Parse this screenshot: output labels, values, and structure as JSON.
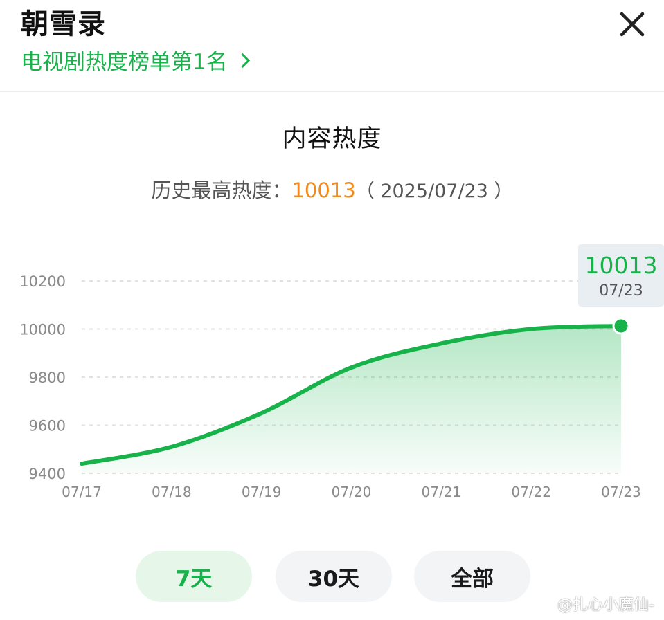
{
  "header": {
    "title": "朝雪录",
    "subtitle": "电视剧热度榜单第1名"
  },
  "section": {
    "title": "内容热度",
    "peak_label": "历史最高热度：",
    "peak_value": "10013",
    "peak_date": "（ 2025/07/23 ）"
  },
  "chart_data": {
    "type": "area",
    "categories": [
      "07/17",
      "07/18",
      "07/19",
      "07/20",
      "07/21",
      "07/22",
      "07/23"
    ],
    "series": [
      {
        "values": [
          9440,
          9510,
          9650,
          9840,
          9940,
          10000,
          10013
        ]
      }
    ],
    "ylim": [
      9400,
      10200
    ],
    "yticks": [
      "10200",
      "10000",
      "9800",
      "9600",
      "9400"
    ],
    "grid": true,
    "line_color": "#17b34a",
    "fill_color": "#17b34a",
    "tooltip": {
      "value": "10013",
      "date": "07/23"
    }
  },
  "tabs": [
    {
      "label": "7天",
      "active": true
    },
    {
      "label": "30天",
      "active": false
    },
    {
      "label": "全部",
      "active": false
    }
  ],
  "colors": {
    "accent": "#17b34a",
    "peak": "#f08a1c"
  },
  "watermark": "@扎心小魔仙-"
}
